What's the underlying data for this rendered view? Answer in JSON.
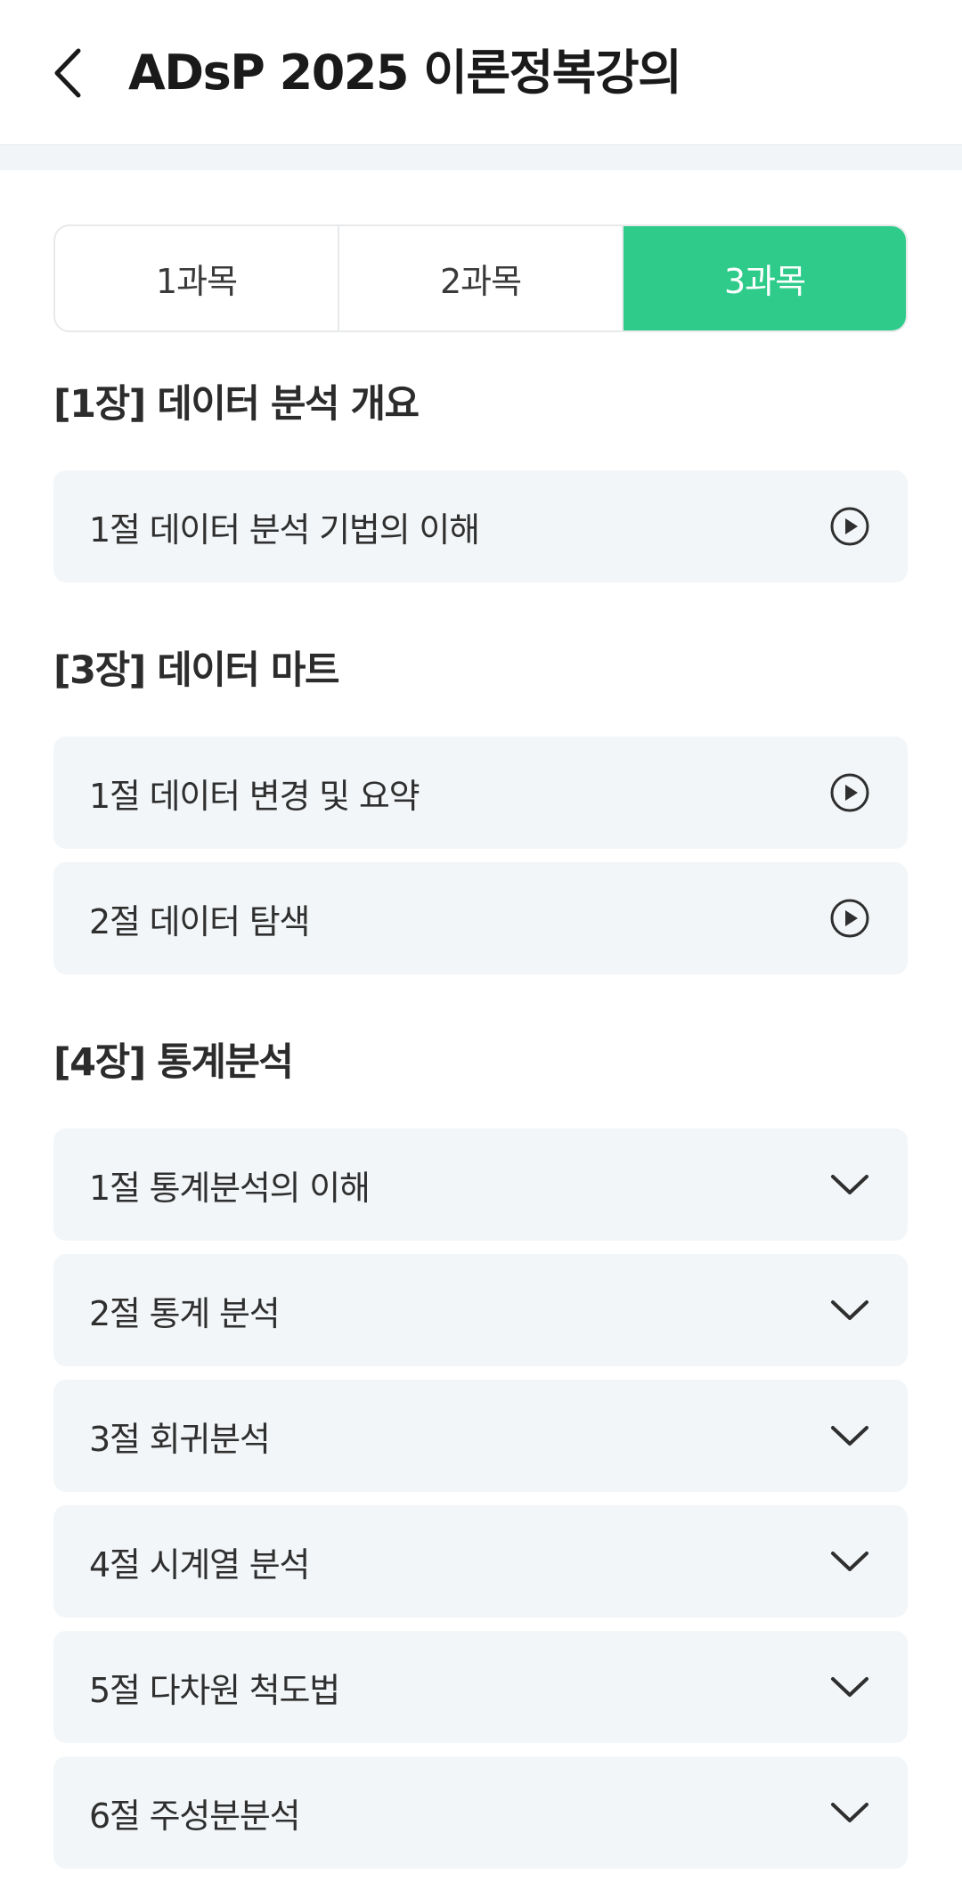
{
  "header": {
    "back_icon": "chevron-left-icon",
    "title": "ADsP 2025 이론정복강의"
  },
  "tabs": [
    {
      "label": "1과목",
      "active": false
    },
    {
      "label": "2과목",
      "active": false
    },
    {
      "label": "3과목",
      "active": true
    }
  ],
  "accent_color": "#2ecb8a",
  "chapters": [
    {
      "title": "[1장] 데이터 분석 개요",
      "lessons": [
        {
          "label": "1절 데이터 분석 기법의 이해",
          "icon": "play-circle-icon"
        }
      ]
    },
    {
      "title": "[3장] 데이터 마트",
      "lessons": [
        {
          "label": "1절 데이터 변경 및 요약",
          "icon": "play-circle-icon"
        },
        {
          "label": "2절 데이터 탐색",
          "icon": "play-circle-icon"
        }
      ]
    },
    {
      "title": "[4장] 통계분석",
      "lessons": [
        {
          "label": "1절 통계분석의 이해",
          "icon": "chevron-down-icon"
        },
        {
          "label": "2절 통계 분석",
          "icon": "chevron-down-icon"
        },
        {
          "label": "3절 회귀분석",
          "icon": "chevron-down-icon"
        },
        {
          "label": "4절 시계열 분석",
          "icon": "chevron-down-icon"
        },
        {
          "label": "5절 다차원 척도법",
          "icon": "chevron-down-icon"
        },
        {
          "label": "6절 주성분분석",
          "icon": "chevron-down-icon"
        }
      ]
    }
  ]
}
